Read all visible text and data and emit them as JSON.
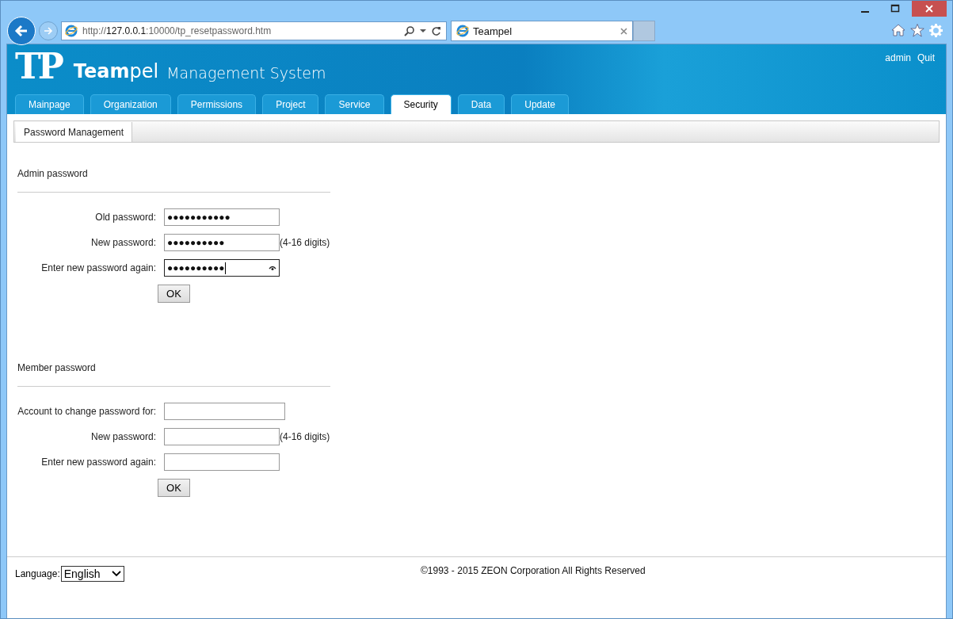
{
  "browser": {
    "address": {
      "prefix": "http://",
      "host": "127.0.0.1",
      "rest": ":10000/tp_resetpassword.htm"
    },
    "tab": {
      "title": "Teampel"
    }
  },
  "header": {
    "logo": "TP",
    "brand_bold": "Team",
    "brand_light": "pel",
    "subtitle": "Management System",
    "user_links": [
      "admin",
      "Quit"
    ]
  },
  "tabs": [
    {
      "label": "Mainpage",
      "selected": false
    },
    {
      "label": "Organization",
      "selected": false
    },
    {
      "label": "Permissions",
      "selected": false
    },
    {
      "label": "Project",
      "selected": false
    },
    {
      "label": "Service",
      "selected": false
    },
    {
      "label": "Security",
      "selected": true
    },
    {
      "label": "Data",
      "selected": false
    },
    {
      "label": "Update",
      "selected": false
    }
  ],
  "subtabs": [
    {
      "label": "Password Management",
      "selected": true
    }
  ],
  "sections": [
    {
      "title": "Admin password",
      "fields": [
        {
          "label": "Old password:",
          "value": "●●●●●●●●●●●",
          "focused": false
        },
        {
          "label": "New password:",
          "value": "●●●●●●●●●●",
          "hint": "(4-16 digits)",
          "focused": false
        },
        {
          "label": "Enter new password again:",
          "value": "●●●●●●●●●●",
          "focused": true
        }
      ],
      "button": "OK"
    },
    {
      "title": "Member password",
      "fields": [
        {
          "label": "Account to change password for:",
          "focused": false
        },
        {
          "label": "New password:",
          "hint": "(4-16 digits)",
          "focused": false
        },
        {
          "label": "Enter new password again:",
          "focused": false
        }
      ],
      "button": "OK"
    }
  ],
  "footer": {
    "language_label": "Language:",
    "language_value": "English",
    "copyright": "©1993 - 2015 ZEON Corporation All Rights Reserved"
  }
}
